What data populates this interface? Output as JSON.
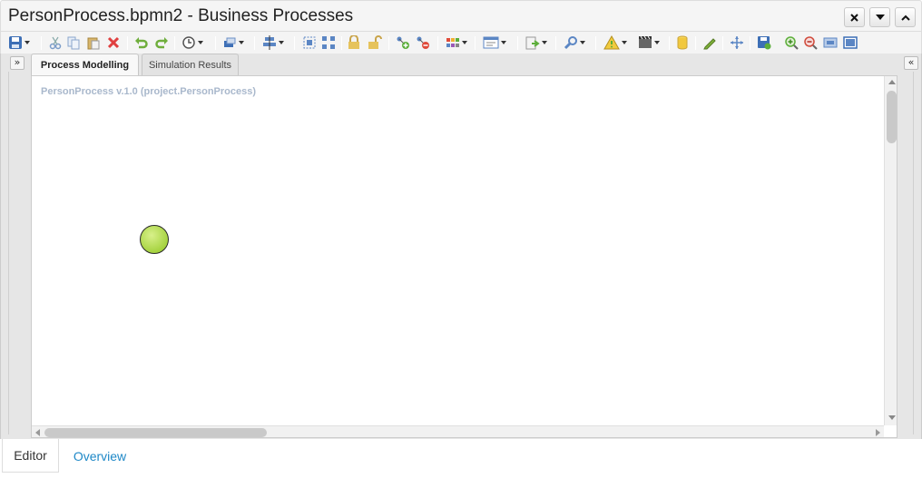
{
  "window": {
    "title": "PersonProcess.bpmn2 - Business Processes",
    "controls": [
      "close-icon",
      "dropdown-icon",
      "collapse-up-icon"
    ]
  },
  "toolbar": {
    "icons": [
      "save-icon",
      "cut-icon",
      "copy-icon",
      "paste-icon",
      "delete-icon",
      "undo-icon",
      "redo-icon",
      "history-icon",
      "shapes-icon",
      "align-icon",
      "group-icon",
      "ungroup-icon",
      "lock-icon",
      "unlock-icon",
      "add-node-icon",
      "remove-node-icon",
      "palette-icon",
      "properties-icon",
      "export-icon",
      "validate-icon",
      "warning-icon",
      "simulation-icon",
      "database-icon",
      "edit-icon",
      "fit-icon",
      "save-as-icon",
      "zoom-in-icon",
      "zoom-out-icon",
      "actual-size-icon",
      "fullscreen-icon"
    ]
  },
  "tabs": [
    {
      "label": "Process Modelling",
      "active": true
    },
    {
      "label": "Simulation Results",
      "active": false
    }
  ],
  "canvas": {
    "process_label": "PersonProcess v.1.0 (project.PersonProcess)",
    "start_event": {
      "type": "start-event",
      "color": "#a6d340"
    }
  },
  "panels": {
    "left_collapse": "»",
    "right_collapse": "«"
  },
  "bottom_tabs": [
    {
      "label": "Editor",
      "active": true
    },
    {
      "label": "Overview",
      "active": false
    }
  ],
  "colors": {
    "link": "#1e88c7",
    "process_label": "#a9b8cc"
  }
}
